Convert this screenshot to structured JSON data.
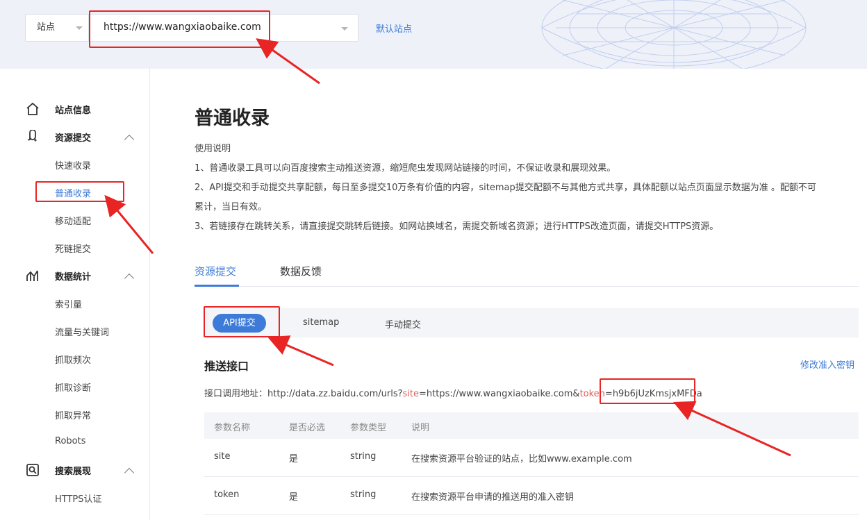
{
  "header": {
    "site_label": "站点",
    "site_url": "https://www.wangxiaobaike.com",
    "default_site_link": "默认站点"
  },
  "sidebar": {
    "groups": [
      {
        "label": "站点信息",
        "icon": "home-icon"
      },
      {
        "label": "资源提交",
        "icon": "submit-link-icon",
        "items": [
          "快速收录",
          "普通收录",
          "移动适配",
          "死链提交"
        ]
      },
      {
        "label": "数据统计",
        "icon": "stats-chart-icon",
        "items": [
          "索引量",
          "流量与关键词",
          "抓取频次",
          "抓取诊断",
          "抓取异常",
          "Robots"
        ]
      },
      {
        "label": "搜索展现",
        "icon": "search-display-icon",
        "items": [
          "HTTPS认证"
        ]
      }
    ],
    "active_item": "普通收录"
  },
  "main": {
    "title": "普通收录",
    "description": [
      "使用说明",
      "1、普通收录工具可以向百度搜索主动推送资源，缩短爬虫发现网站链接的时间，不保证收录和展现效果。",
      "2、API提交和手动提交共享配额，每日至多提交10万条有价值的内容，sitemap提交配额不与其他方式共享，具体配额以站点页面显示数据为准 。配额不可",
      "累计，当日有效。",
      "3、若链接存在跳转关系，请直接提交跳转后链接。如网站换域名，需提交新域名资源；进行HTTPS改造页面，请提交HTTPS资源。"
    ],
    "tabs": [
      "资源提交",
      "数据反馈"
    ],
    "subtabs": [
      "API提交",
      "sitemap",
      "手动提交"
    ],
    "push_section_title": "推送接口",
    "edit_key_link": "修改准入密钥",
    "endpoint": {
      "prefix": "接口调用地址：http://data.zz.baidu.com/urls?",
      "param_site": "site",
      "site_value": "=https://www.wangxiaobaike.com&",
      "param_token": "token",
      "token_value": "=h9b6jUzKmsjxMFDa"
    },
    "table": {
      "headers": [
        "参数名称",
        "是否必选",
        "参数类型",
        "说明"
      ],
      "rows": [
        [
          "site",
          "是",
          "string",
          "在搜索资源平台验证的站点，比如www.example.com"
        ],
        [
          "token",
          "是",
          "string",
          "在搜索资源平台申请的推送用的准入密钥"
        ]
      ]
    }
  },
  "colors": {
    "accent": "#3e7bd8",
    "annotation_red": "#e82424",
    "header_bg": "#eef1f8"
  }
}
